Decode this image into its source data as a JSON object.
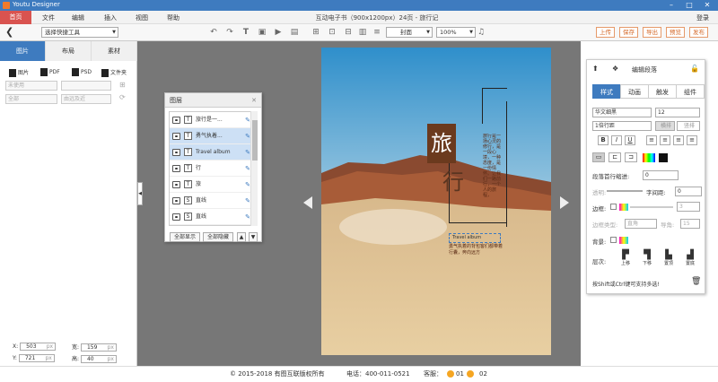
{
  "titlebar": {
    "app_name": "Youtu Designer"
  },
  "menu": {
    "home": "首页",
    "items": [
      "文件",
      "编辑",
      "插入",
      "视图",
      "帮助"
    ],
    "doc_title": "互动电子书（900x1200px）24页 - 旅行记",
    "login": "登录"
  },
  "toolbar": {
    "quick_tools": "选择快捷工具",
    "page_select": "封面",
    "zoom": "100%",
    "buttons": [
      "上传",
      "保存",
      "导出",
      "预览",
      "发布"
    ]
  },
  "left_panel": {
    "tabs": [
      "图片",
      "布局",
      "素材"
    ],
    "file_types": [
      "图片",
      "PDF",
      "PSD",
      "文件夹"
    ],
    "filter1": "未使用",
    "filter2": "全部",
    "filter3": "由远及近",
    "coords": {
      "x_label": "X:",
      "x": "503",
      "y_label": "Y:",
      "y": "721",
      "w_label": "宽:",
      "w": "159",
      "h_label": "高:",
      "h": "40",
      "unit": "px"
    }
  },
  "layers": {
    "title": "图层",
    "items": [
      {
        "icon": "T",
        "name": "旅行是一..."
      },
      {
        "icon": "T",
        "name": "勇气执着..."
      },
      {
        "icon": "T",
        "name": "Travel album"
      },
      {
        "icon": "T",
        "name": "行"
      },
      {
        "icon": "T",
        "name": "旅"
      },
      {
        "icon": "S",
        "name": "直线"
      },
      {
        "icon": "S",
        "name": "直线"
      }
    ],
    "show_all": "全部显示",
    "hide_all": "全部隐藏"
  },
  "page": {
    "char1": "旅",
    "char2": "行",
    "vertical_text": "旅行是一场心灵的修行，是一段心境，一种态度，是一份情怀。让我们一路前行，一个人的旅程，",
    "travel_album": "Travel album",
    "subtitle": "勇气执着的背包客们都带着行囊，奔向远方"
  },
  "right_panel": {
    "title": "编辑段落",
    "tabs": [
      "样式",
      "动画",
      "触发",
      "组件"
    ],
    "font": "华文细黑",
    "size": "12",
    "line_spacing": "1倍行距",
    "h_text": "横排",
    "v_text": "竖排",
    "indent_label": "段落首行缩进:",
    "indent_value": "0",
    "opacity_label": "透明:",
    "char_spacing_label": "字间距:",
    "char_spacing": "0",
    "border_label": "边框:",
    "border_value": "3",
    "border_type_label": "边框类型:",
    "border_type": "直角",
    "corner_label": "导角:",
    "corner_value": "15",
    "bg_label": "背景:",
    "layer_label": "层次:",
    "layer_buttons": [
      "上移",
      "下移",
      "置顶",
      "置底"
    ],
    "hint": "按Shift或Ctrl键可支持多选!"
  },
  "footer": {
    "copyright": "© 2015-2018 有图互联版权所有",
    "phone": "电话：400-011-0521",
    "service": "客服：",
    "s1": "01",
    "s2": "02"
  },
  "colors": {
    "accent": "#3e7bbf",
    "home": "#d9534f",
    "brown": "#6b3a1e"
  }
}
